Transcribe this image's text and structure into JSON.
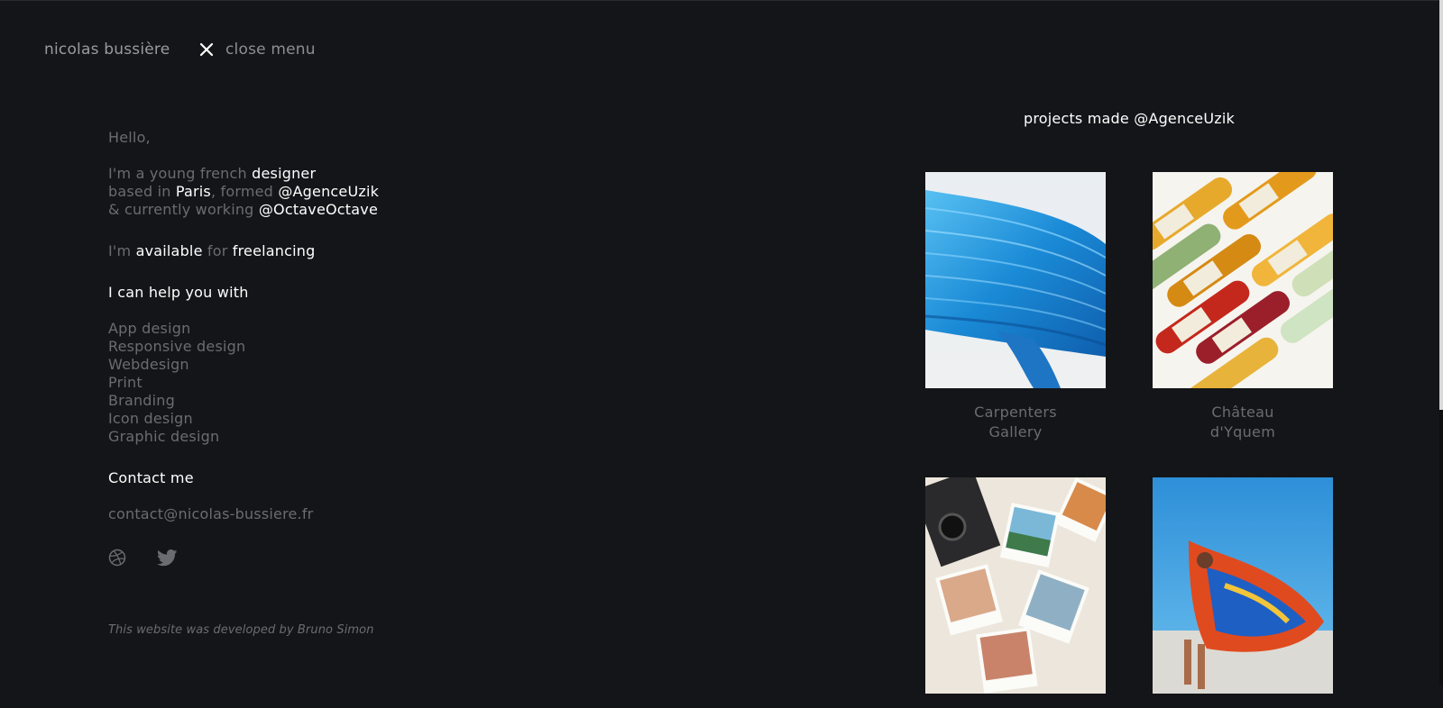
{
  "header": {
    "brand": "nicolas bussière",
    "close_label": "close menu"
  },
  "bio": {
    "greeting": "Hello,",
    "line1_pre": "I'm a young french ",
    "line1_hi": "designer",
    "line2_pre": "based in ",
    "line2_hi1": "Paris",
    "line2_mid": ", formed ",
    "line2_hi2": "@AgenceUzik",
    "line3_pre": "& currently working ",
    "line3_hi": "@OctaveOctave",
    "avail_pre": "I'm ",
    "avail_hi1": "available",
    "avail_mid": " for ",
    "avail_hi2": "freelancing",
    "help_heading": "I can help you with",
    "services": [
      "App design",
      "Responsive design",
      "Webdesign",
      "Print",
      "Branding",
      "Icon design",
      "Graphic design"
    ],
    "contact_heading": "Contact me",
    "email": "contact@nicolas-bussiere.fr"
  },
  "social": {
    "icons": [
      "dribbble-icon",
      "twitter-icon"
    ]
  },
  "credit": "This website was developed by Bruno Simon",
  "projects": {
    "title": "projects made @AgenceUzik",
    "items": [
      {
        "line1": "Carpenters",
        "line2": "Gallery"
      },
      {
        "line1": "Château",
        "line2": "d'Yquem"
      },
      {
        "line1": "",
        "line2": ""
      },
      {
        "line1": "",
        "line2": ""
      }
    ]
  },
  "colors": {
    "background": "#141518",
    "text_dim": "#6b6c71",
    "text_highlight": "#ffffff"
  }
}
